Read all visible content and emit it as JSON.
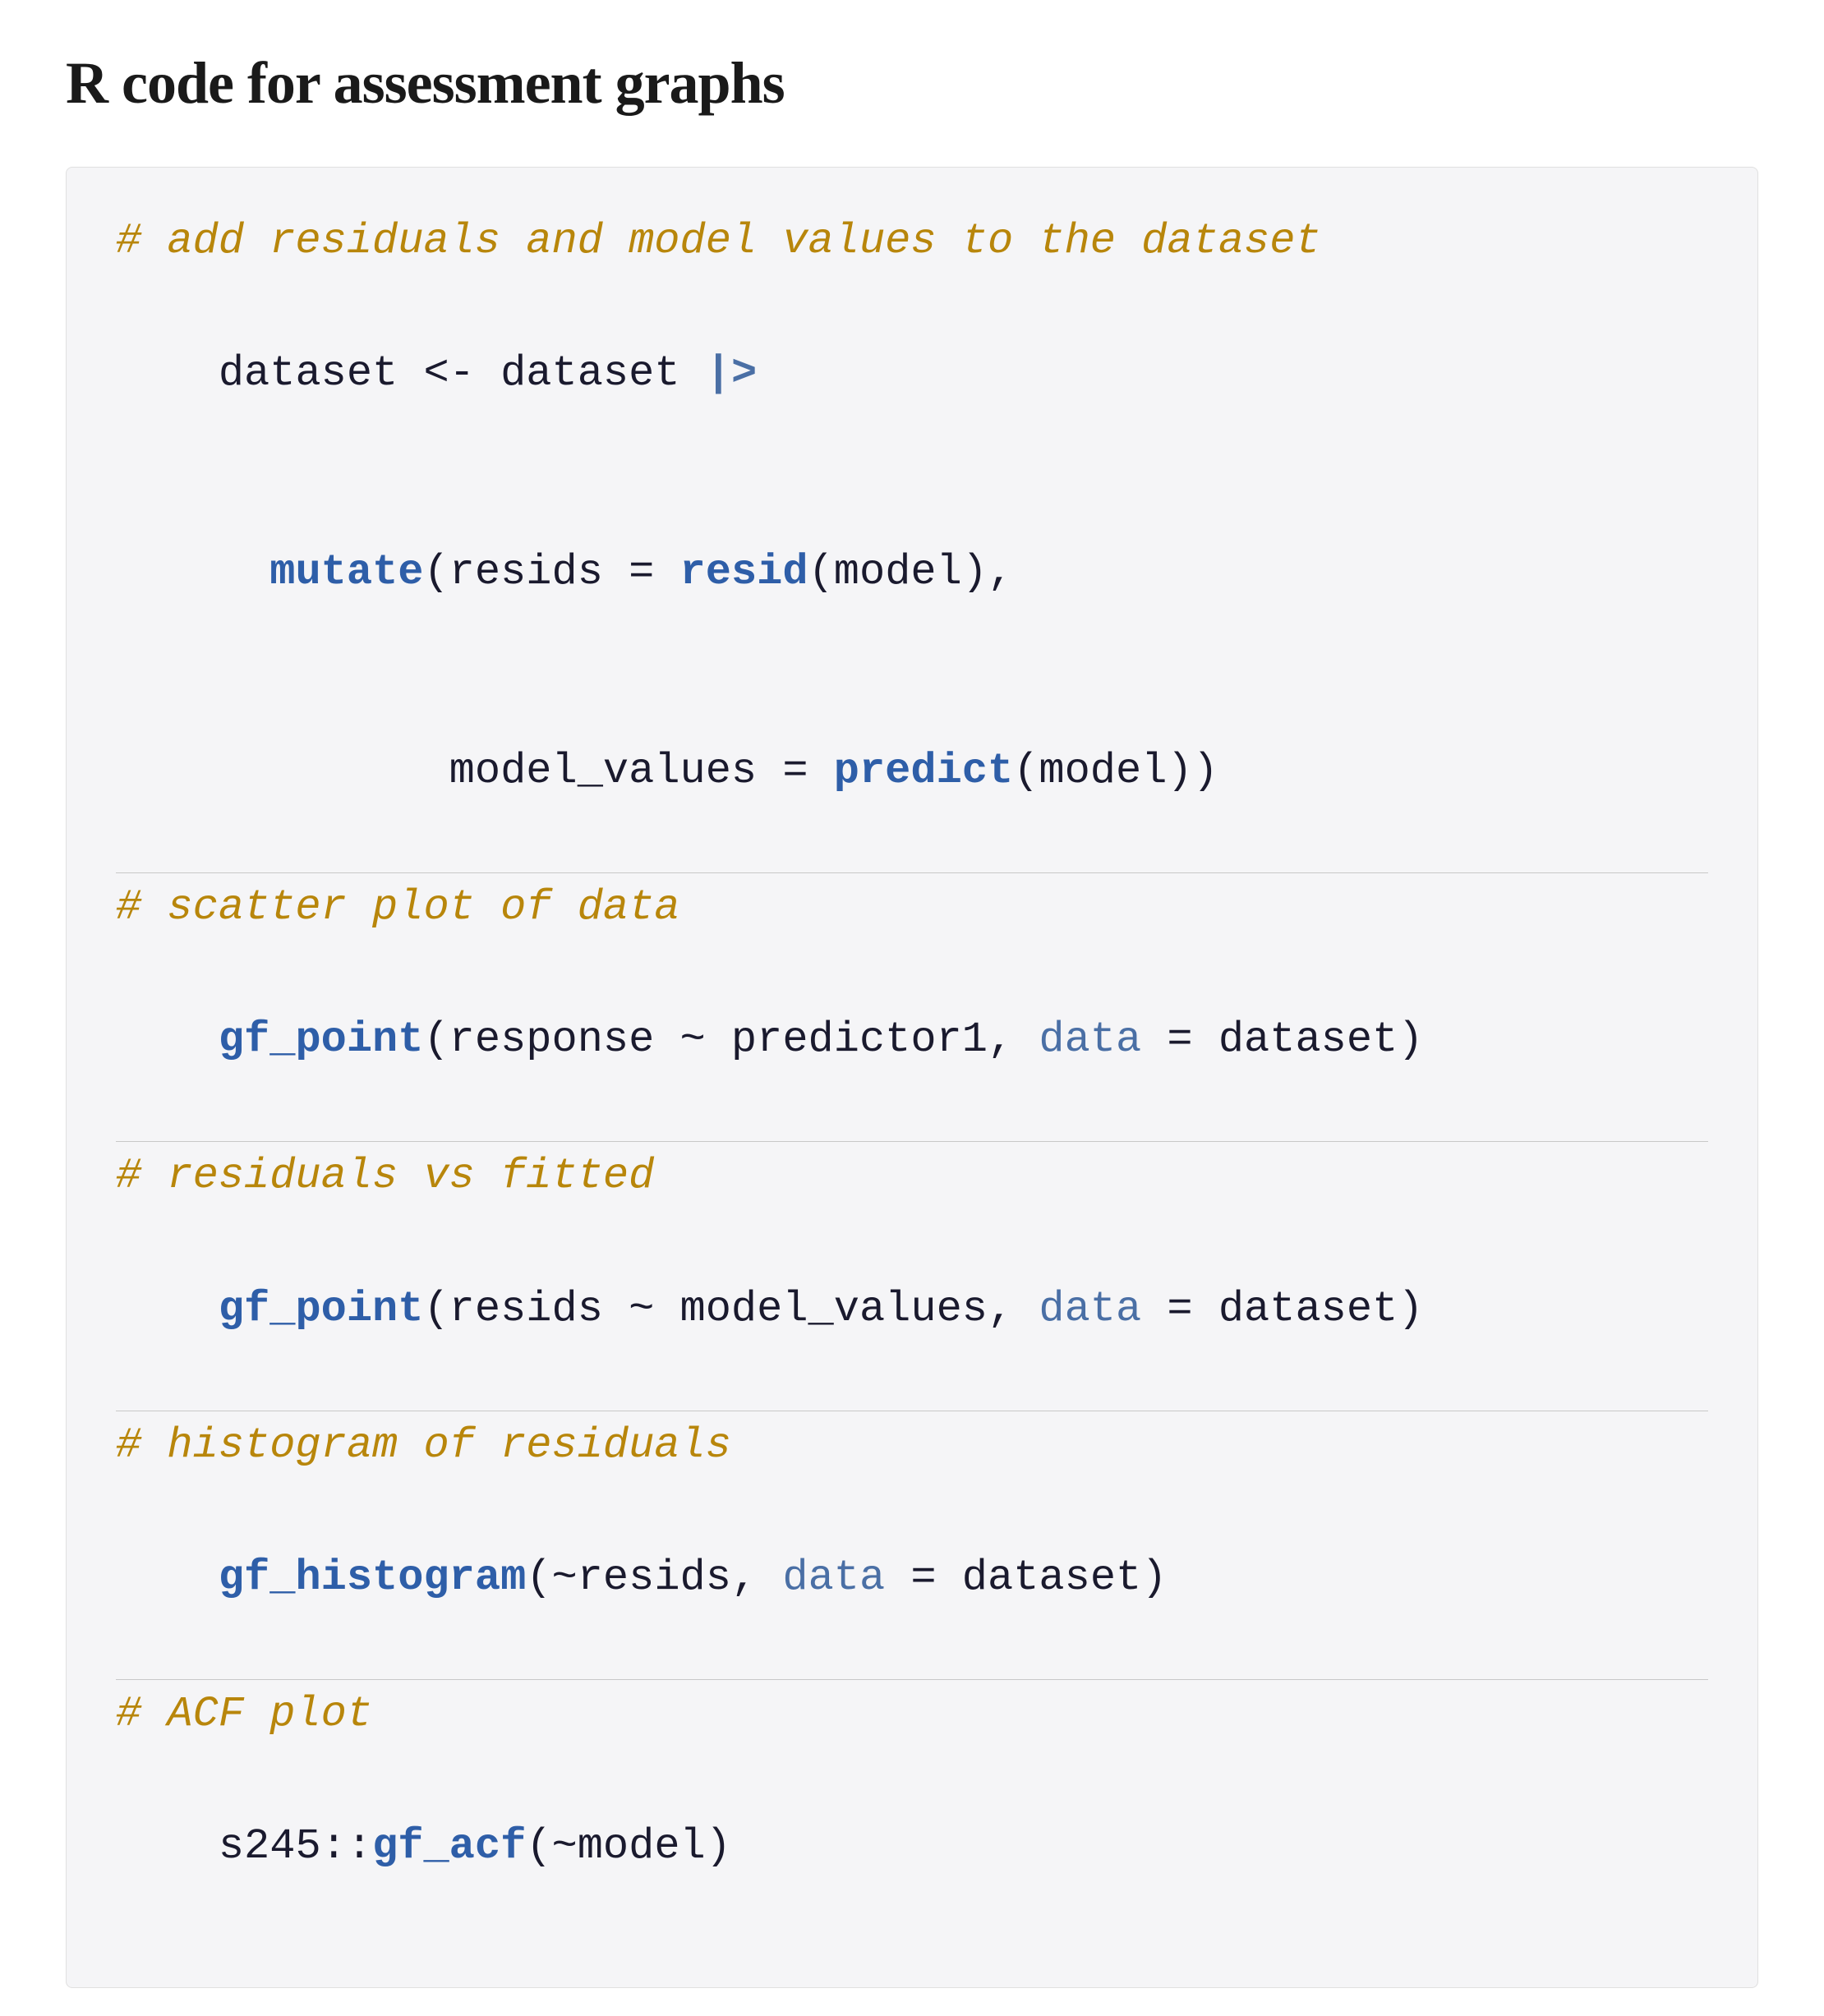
{
  "page": {
    "title": "R code for assessment graphs"
  },
  "code": {
    "comment1": "# add residuals and model values to the dataset",
    "line1": "dataset <- dataset |>",
    "line2": "  mutate(resids = resid(model),",
    "line3": "         model_values = predict(model))",
    "comment2": "# scatter plot of data",
    "line4": "gf_point(response ~ predictor1, data = dataset)",
    "comment3": "# residuals vs fitted",
    "line5": "gf_point(resids ~ model_values, data = dataset)",
    "comment4": "# histogram of residuals",
    "line6": "gf_histogram(~resids, data = dataset)",
    "comment5": "# ACF plot",
    "line7": "s245::gf_acf(~model)"
  }
}
